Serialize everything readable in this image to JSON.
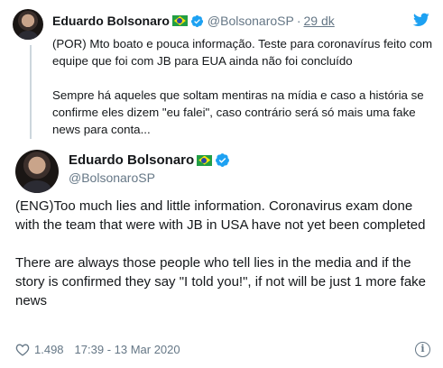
{
  "parent": {
    "author_name": "Eduardo Bolsonaro",
    "author_handle": "@BolsonaroSP",
    "separator": "·",
    "time": "29 dk",
    "paragraphs": [
      "(POR) Mto boato e pouca informação. Teste para coronavírus feito com equipe que foi com JB para EUA ainda não foi concluído",
      "Sempre há aqueles que soltam mentiras na mídia e caso a história se confirme eles dizem \"eu falei\", caso contrário será só mais uma fake news para conta..."
    ]
  },
  "tweet": {
    "author_name": "Eduardo Bolsonaro",
    "author_handle": "@BolsonaroSP",
    "paragraphs": [
      "(ENG)Too much lies and little information. Coronavirus exam done with the team that were with JB in USA have not yet been completed",
      "There are always those people who tell lies in the media and if the story is confirmed they say \"I told you!\", if not will be just 1 more fake news"
    ],
    "like_count": "1.498",
    "timestamp": "17:39 - 13 Mar 2020"
  },
  "icons": {
    "brand": "twitter-bird-icon",
    "verified": "verified-badge-icon",
    "flag": "brazil-flag-icon",
    "like": "heart-icon",
    "info": "info-icon"
  },
  "colors": {
    "twitter_blue": "#1da1f2",
    "secondary_text": "#657786",
    "primary_text": "#14171a"
  }
}
